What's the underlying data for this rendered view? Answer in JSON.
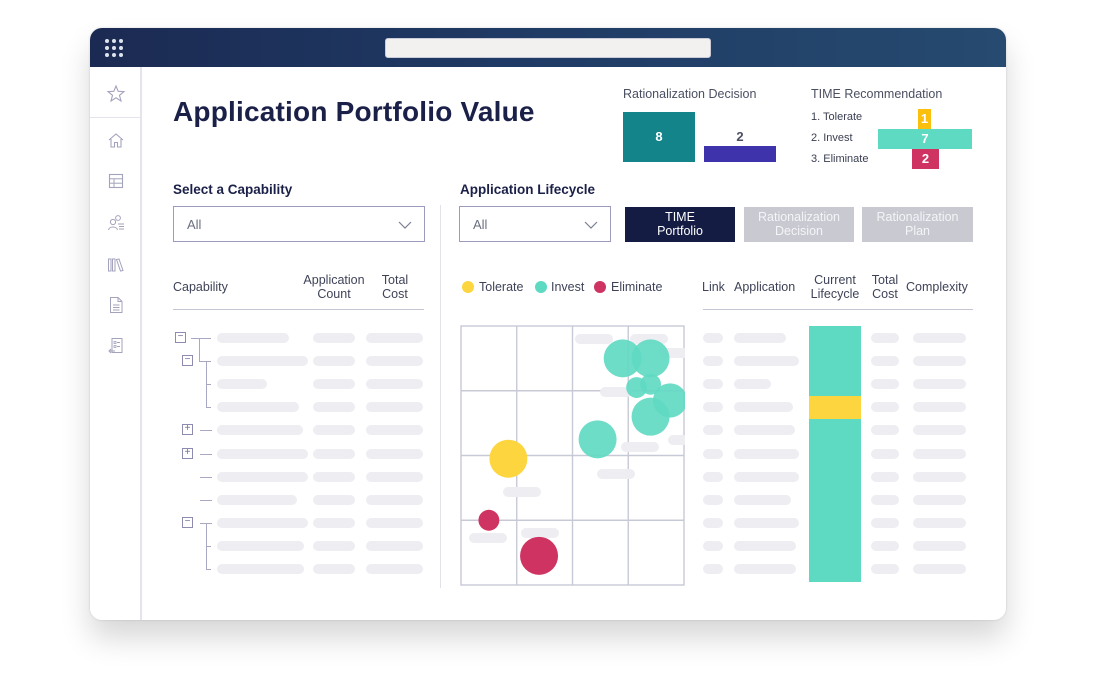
{
  "window": {
    "url_bar_value": ""
  },
  "sidebar": {
    "items": [
      {
        "icon": "star-icon",
        "label": "Favorites"
      },
      {
        "icon": "home-icon",
        "label": "Home"
      },
      {
        "icon": "table-icon",
        "label": "Tables"
      },
      {
        "icon": "users-list-icon",
        "label": "People"
      },
      {
        "icon": "library-icon",
        "label": "Library"
      },
      {
        "icon": "document-icon",
        "label": "Documents"
      },
      {
        "icon": "checklist-icon",
        "label": "Checklist"
      }
    ]
  },
  "header": {
    "title": "Application Portfolio Value"
  },
  "rationalization_decision": {
    "label": "Rationalization Decision",
    "bars": [
      {
        "value": 8,
        "color": "#12848a"
      },
      {
        "value": 2,
        "color": "#3e33aa"
      }
    ]
  },
  "time_recommendation": {
    "label": "TIME Recommendation",
    "rows": [
      {
        "label": "1. Tolerate",
        "value": 1,
        "color": "#fbbf0e"
      },
      {
        "label": "2. Invest",
        "value": 7,
        "color": "#5ed9c2"
      },
      {
        "label": "3. Eliminate",
        "value": 2,
        "color": "#cf3361"
      }
    ]
  },
  "capability": {
    "section_label": "Select a Capability",
    "select_value": "All",
    "columns": [
      "Capability",
      "Application\nCount",
      "Total\nCost"
    ],
    "tree_toggles": [
      "−",
      "−",
      "+",
      "+",
      "−"
    ]
  },
  "lifecycle": {
    "section_label": "Application Lifecycle",
    "select_value": "All",
    "tabs": [
      {
        "label": "TIME\nPortfolio",
        "active": true
      },
      {
        "label": "Rationalization\nDecision",
        "active": false
      },
      {
        "label": "Rationalization\nPlan",
        "active": false
      }
    ],
    "legend": [
      {
        "label": "Tolerate",
        "color": "#fcd53f"
      },
      {
        "label": "Invest",
        "color": "#5ed9c2"
      },
      {
        "label": "Eliminate",
        "color": "#cf3361"
      }
    ],
    "table_columns": [
      "Link",
      "Application",
      "Current\nLifecycle",
      "Total\nCost",
      "Complexity"
    ],
    "current_lifecycle_rows": [
      "Invest",
      "Invest",
      "Invest",
      "Tolerate",
      "Invest",
      "Invest",
      "Invest",
      "Invest",
      "Invest",
      "Invest",
      "Invest"
    ]
  },
  "chart_data": {
    "type": "scatter",
    "title": "",
    "xlabel": "",
    "ylabel": "",
    "xlim": [
      0,
      4
    ],
    "ylim": [
      0,
      4
    ],
    "grid": true,
    "legend": "top-left",
    "series": [
      {
        "name": "Tolerate",
        "color": "#fcd53f",
        "points": [
          {
            "x": 0.85,
            "y": 1.95,
            "size": 1.0
          }
        ]
      },
      {
        "name": "Invest",
        "color": "#5ed9c2",
        "points": [
          {
            "x": 2.9,
            "y": 3.5,
            "size": 1.0
          },
          {
            "x": 3.4,
            "y": 3.5,
            "size": 1.0
          },
          {
            "x": 3.15,
            "y": 3.05,
            "size": 0.55
          },
          {
            "x": 3.4,
            "y": 3.1,
            "size": 0.55
          },
          {
            "x": 3.75,
            "y": 2.85,
            "size": 0.9
          },
          {
            "x": 3.4,
            "y": 2.6,
            "size": 1.0
          },
          {
            "x": 2.45,
            "y": 2.25,
            "size": 1.0
          }
        ]
      },
      {
        "name": "Eliminate",
        "color": "#cf3361",
        "points": [
          {
            "x": 0.5,
            "y": 1.0,
            "size": 0.55
          },
          {
            "x": 1.4,
            "y": 0.45,
            "size": 1.0
          }
        ]
      }
    ]
  }
}
